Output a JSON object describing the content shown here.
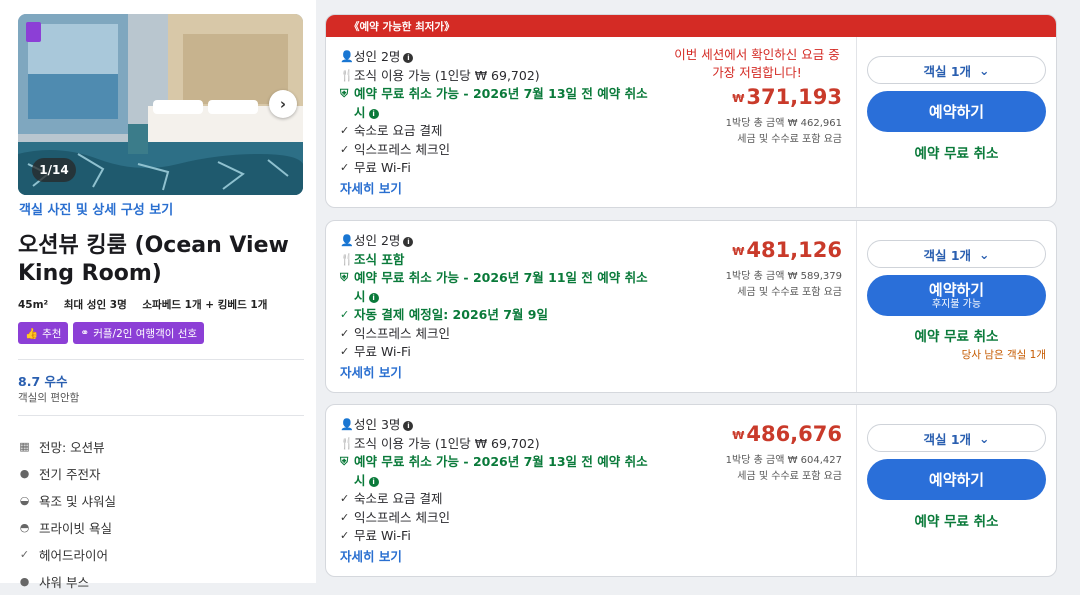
{
  "room": {
    "photo_counter": "1/14",
    "photo_link": "객실 사진 및 상세 구성 보기",
    "title": "오션뷰 킹룸 (Ocean View King Room)",
    "specs": [
      "45m²",
      "최대 성인 3명",
      "소파베드 1개 + 킹베드 1개"
    ],
    "tags": [
      {
        "icon": "thumbs-up-icon",
        "label": "추천"
      },
      {
        "icon": "couple-icon",
        "label": "커플/2인 여행객이 선호"
      }
    ],
    "score": "8.7 우수",
    "score_sub": "객실의 편안함",
    "amenities": [
      {
        "icon": "view-icon",
        "label": "전망: 오션뷰"
      },
      {
        "icon": "check-circle-icon",
        "label": "전기 주전자"
      },
      {
        "icon": "bathtub-icon",
        "label": "욕조 및 샤워실"
      },
      {
        "icon": "bath-icon",
        "label": "프라이빗 욕실"
      },
      {
        "icon": "check-icon",
        "label": "헤어드라이어"
      },
      {
        "icon": "check-circle-icon",
        "label": "샤워 부스"
      }
    ]
  },
  "offers": [
    {
      "banner": "《예약 가능한 최저가》",
      "features": [
        {
          "type": "plain",
          "icon": "person-icon",
          "text": "성인 2명",
          "info": true
        },
        {
          "type": "plain",
          "icon": "fork-knife-icon",
          "text": "조식 이용 가능 (1인당 ₩ 69,702)"
        },
        {
          "type": "green",
          "icon": "shield-check-icon",
          "text": "예약 무료 취소 가능 - 2026년 7월 13일 전 예약 취소 시",
          "info": true
        },
        {
          "type": "plain",
          "icon": "check-icon",
          "text": "숙소로 요금 결제"
        },
        {
          "type": "plain",
          "icon": "check-icon",
          "text": "익스프레스 체크인"
        },
        {
          "type": "plain",
          "icon": "check-icon",
          "text": "무료 Wi-Fi"
        }
      ],
      "more": "자세히 보기",
      "message": "이번 세션에서 확인하신 요금 중 가장 저렴합니다!",
      "currency": "₩",
      "price": "371,193",
      "price_sub1": "1박당 총 금액 ₩ 462,961",
      "price_sub2": "세금 및 수수료 포함 요금",
      "room_select": "객실 1개",
      "book_label": "예약하기",
      "book_sub": "",
      "free_cancel": "예약 무료 취소",
      "rooms_left": ""
    },
    {
      "banner": "",
      "features": [
        {
          "type": "plain",
          "icon": "person-icon",
          "text": "성인 2명",
          "info": true
        },
        {
          "type": "green",
          "icon": "fork-knife-icon",
          "text": "조식 포함"
        },
        {
          "type": "green",
          "icon": "shield-check-icon",
          "text": "예약 무료 취소 가능 - 2026년 7월 11일 전 예약 취소 시",
          "info": true
        },
        {
          "type": "green",
          "icon": "check-icon",
          "text": "자동 결제 예정일: 2026년 7월 9일"
        },
        {
          "type": "plain",
          "icon": "check-icon",
          "text": "익스프레스 체크인"
        },
        {
          "type": "plain",
          "icon": "check-icon",
          "text": "무료 Wi-Fi"
        }
      ],
      "more": "자세히 보기",
      "message": "",
      "currency": "₩",
      "price": "481,126",
      "price_sub1": "1박당 총 금액 ₩ 589,379",
      "price_sub2": "세금 및 수수료 포함 요금",
      "room_select": "객실 1개",
      "book_label": "예약하기",
      "book_sub": "후지불 가능",
      "free_cancel": "예약 무료 취소",
      "rooms_left": "당사 남은 객실 1개"
    },
    {
      "banner": "",
      "features": [
        {
          "type": "plain",
          "icon": "person-icon",
          "text": "성인 3명",
          "info": true
        },
        {
          "type": "plain",
          "icon": "fork-knife-icon",
          "text": "조식 이용 가능 (1인당 ₩ 69,702)"
        },
        {
          "type": "green",
          "icon": "shield-check-icon",
          "text": "예약 무료 취소 가능 - 2026년 7월 13일 전 예약 취소 시",
          "info": true
        },
        {
          "type": "plain",
          "icon": "check-icon",
          "text": "숙소로 요금 결제"
        },
        {
          "type": "plain",
          "icon": "check-icon",
          "text": "익스프레스 체크인"
        },
        {
          "type": "plain",
          "icon": "check-icon",
          "text": "무료 Wi-Fi"
        }
      ],
      "more": "자세히 보기",
      "message": "",
      "currency": "₩",
      "price": "486,676",
      "price_sub1": "1박당 총 금액 ₩ 604,427",
      "price_sub2": "세금 및 수수료 포함 요금",
      "room_select": "객실 1개",
      "book_label": "예약하기",
      "book_sub": "",
      "free_cancel": "예약 무료 취소",
      "rooms_left": ""
    }
  ],
  "colors": {
    "accent_blue": "#2a6fd9",
    "banner_red": "#d42b25",
    "price_red": "#c93a2a",
    "green": "#0a7a3a",
    "tag_purple": "#8c3fd6"
  }
}
